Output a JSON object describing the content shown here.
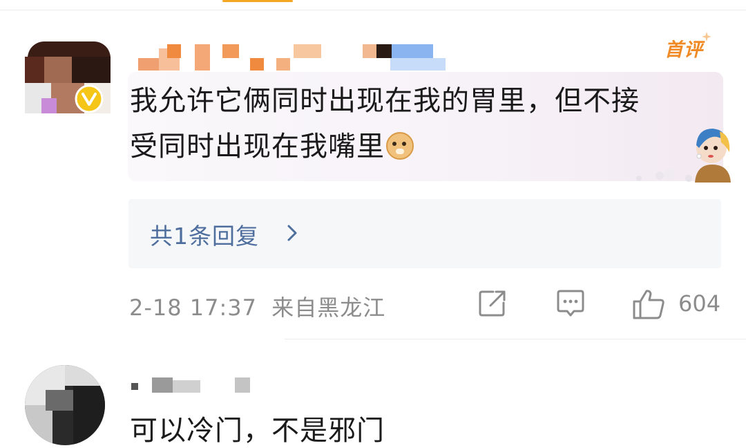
{
  "comments": [
    {
      "badge": "首评",
      "text_line1": "我允许它俩同时出现在我的胃里，但不接",
      "text_line2": "受同时出现在我嘴里",
      "emoji": "doge-emoji",
      "replies_label": "共1条回复",
      "timestamp": "2-18 17:37",
      "location": "来自黑龙江",
      "like_count": "604",
      "icons": [
        "share-icon",
        "comment-icon",
        "like-icon",
        "chevron-right-icon",
        "verified-v-icon"
      ],
      "colors": {
        "badge": "#f08a24",
        "link": "#4e6e9e",
        "meta": "#8c8c8c",
        "verified": "#f5c518"
      }
    },
    {
      "text": "可以冷门，不是邪门"
    }
  ]
}
